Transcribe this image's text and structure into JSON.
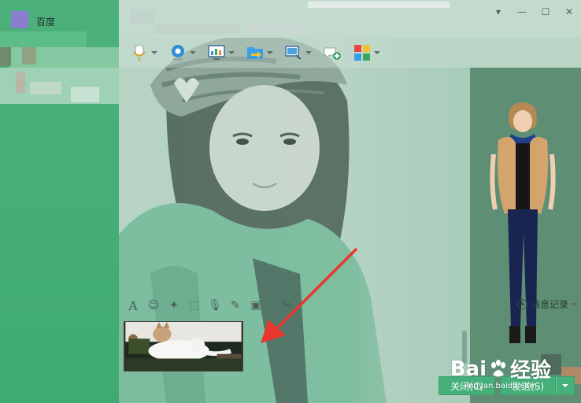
{
  "sidebar": {
    "title": "百度"
  },
  "window": {
    "controls": {
      "minimize": "▾",
      "restore": "—",
      "maximize": "☐",
      "close": "✕"
    }
  },
  "toolbar": {
    "items": [
      {
        "name": "voice-call",
        "icon": "microphone-icon"
      },
      {
        "name": "video-call",
        "icon": "webcam-icon"
      },
      {
        "name": "remote-desktop",
        "icon": "monitor-chart-icon"
      },
      {
        "name": "file-transfer",
        "icon": "folder-arrow-icon"
      },
      {
        "name": "screen-share",
        "icon": "screen-share-icon"
      },
      {
        "name": "add-member",
        "icon": "chat-add-icon"
      },
      {
        "name": "apps",
        "icon": "app-grid-icon"
      }
    ]
  },
  "input_toolbar": {
    "font": "A",
    "emoji": "☺",
    "magic": "✦",
    "screenshot": "⬚",
    "voice": "🎙",
    "image": "▣",
    "scissors": "✂",
    "history_label": "消息记录"
  },
  "buttons": {
    "close_label": "关闭(C)",
    "send_label": "发送(S)"
  },
  "watermark": {
    "brand_left": "Bai",
    "brand_right": "经验",
    "url": "jingyan.baidu.com"
  },
  "colors": {
    "accent": "#45b07a",
    "sidebar": "#3fae74",
    "arrow": "#e8372f"
  }
}
